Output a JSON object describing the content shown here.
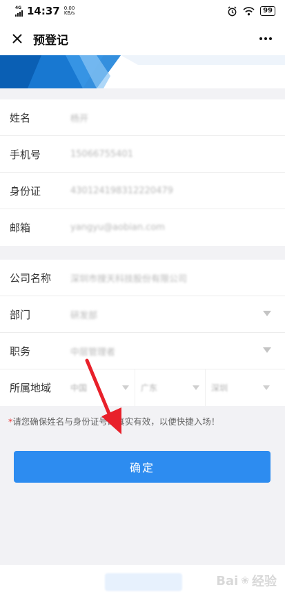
{
  "status_bar": {
    "network": "4G",
    "time": "14:37",
    "speed_value": "0.00",
    "speed_unit": "KB/s",
    "battery": "99"
  },
  "header": {
    "title": "预登记"
  },
  "personal_fields": [
    {
      "label": "姓名",
      "value": "杨开"
    },
    {
      "label": "手机号",
      "value": "15066755401"
    },
    {
      "label": "身份证",
      "value": "430124198312220479"
    },
    {
      "label": "邮箱",
      "value": "yangyu@aobian.com"
    }
  ],
  "company_fields": [
    {
      "label": "公司名称",
      "value": "深圳市搜天科技股份有限公司"
    },
    {
      "label": "部门",
      "value": "研发部"
    },
    {
      "label": "职务",
      "value": "中层管理者"
    }
  ],
  "region": {
    "label": "所属地域",
    "country": "中国",
    "province": "广东",
    "city": "深圳"
  },
  "notice": {
    "star": "*",
    "text": "请您确保姓名与身份证号码真实有效，以便快捷入场！"
  },
  "confirm_label": "确定",
  "watermark": {
    "brand": "Bai",
    "suffix": "经验"
  },
  "colors": {
    "accent": "#2d8cf0",
    "banner_dark": "#0a5fb4",
    "notice_star": "#ee3333",
    "annotation_arrow": "#e8202a"
  }
}
